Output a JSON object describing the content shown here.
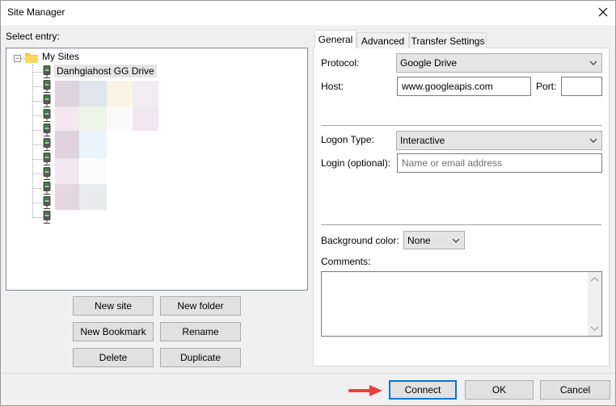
{
  "window": {
    "title": "Site Manager"
  },
  "left": {
    "select_entry_label": "Select entry:",
    "tree": {
      "root": {
        "label": "My Sites",
        "expander": "−"
      },
      "selected_site": "Danhgiahost GG Drive"
    },
    "buttons": {
      "new_site": "New site",
      "new_folder": "New folder",
      "new_bookmark": "New Bookmark",
      "rename": "Rename",
      "delete": "Delete",
      "duplicate": "Duplicate"
    }
  },
  "tabs": [
    {
      "label": "General",
      "active": true
    },
    {
      "label": "Advanced",
      "active": false
    },
    {
      "label": "Transfer Settings",
      "active": false
    }
  ],
  "general": {
    "protocol_label": "Protocol:",
    "protocol_value": "Google Drive",
    "host_label": "Host:",
    "host_value": "www.googleapis.com",
    "port_label": "Port:",
    "port_value": "",
    "logon_type_label": "Logon Type:",
    "logon_type_value": "Interactive",
    "login_label": "Login (optional):",
    "login_placeholder": "Name or email address",
    "bg_color_label": "Background color:",
    "bg_color_value": "None",
    "comments_label": "Comments:",
    "comments_value": ""
  },
  "footer": {
    "connect": "Connect",
    "ok": "OK",
    "cancel": "Cancel"
  },
  "colors": {
    "focus_blue": "#0078d7",
    "arrow_red": "#e8413b",
    "folder_yellow": "#f5c342",
    "server_green": "#3c8f3c"
  }
}
